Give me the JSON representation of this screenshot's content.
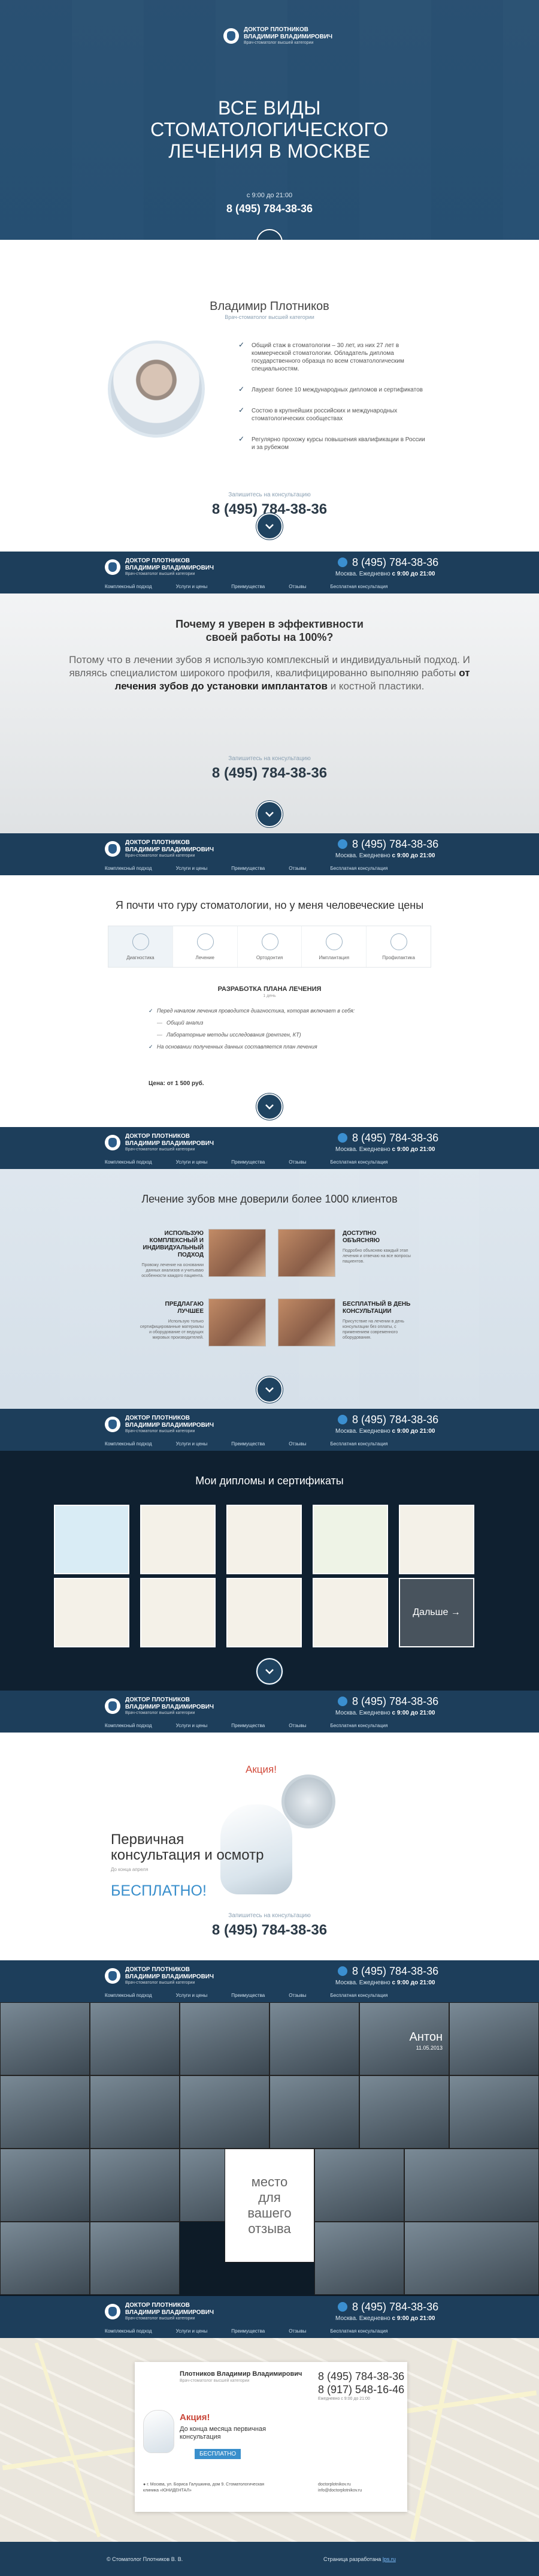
{
  "brand": {
    "name_line1": "ДОКТОР ПЛОТНИКОВ",
    "name_line2": "ВЛАДИМИР ВЛАДИМИРОВИЧ",
    "subtitle": "Врач-стоматолог высшей категории"
  },
  "hero": {
    "title": "ВСЕ ВИДЫ СТОМАТОЛОГИЧЕСКОГО ЛЕЧЕНИЯ В МОСКВЕ",
    "hours": "с 9:00 до 21:00",
    "phone": "8 (495) 784-38-36"
  },
  "doctor": {
    "name": "Владимир Плотников",
    "title": "Врач-стоматолог высшей категории",
    "bullets": [
      "Общий стаж в стоматологии – 30 лет, из них 27 лет в коммерческой стоматологии. Обладатель диплома государственного образца по всем стоматологическим специальностям.",
      "Лауреат более 10 международных дипломов и сертификатов",
      "Состою в крупнейших российских и международных стоматологических сообществах",
      "Регулярно прохожу курсы повышения квалификации в России и за рубежом"
    ],
    "cta_label": "Запишитесь на консультацию",
    "cta_phone": "8 (495) 784-38-36"
  },
  "navbar": {
    "phone": "8 (495) 784-38-36",
    "hours_prefix": "Москва. Ежедневно",
    "hours": "с 9:00 до 21:00",
    "menu": [
      "Комплексный подход",
      "Услуги и цены",
      "Преимущества",
      "Отзывы",
      "Бесплатная консультация"
    ]
  },
  "why": {
    "title_line1": "Почему я уверен в эффективности",
    "title_line2": "своей работы на 100%?",
    "text_part1": "Потому что в лечении зубов я использую комплексный и индивидуальный подход. И являясь специалистом широкого профиля, квалифицированно выполняю работы",
    "text_bold": "от лечения зубов до установки имплантатов",
    "text_part2": "и костной пластики.",
    "cta_label": "Запишитесь на консультацию",
    "cta_phone": "8 (495) 784-38-36"
  },
  "services": {
    "title": "Я почти что гуру стоматологии, но у меня человеческие цены",
    "tabs": [
      "Диагностика",
      "Лечение",
      "Ортодонтия",
      "Имплантация",
      "Профилактика"
    ],
    "plan_title": "РАЗРАБОТКА ПЛАНА ЛЕЧЕНИЯ",
    "plan_sub": "1 день",
    "items": [
      "Перед началом лечения проводится диагностика, которая включает в себя:",
      "Общий анализ",
      "Лабораторные методы исследования (рентген, КТ)",
      "На основании полученных данных составляется план лечения"
    ],
    "price": "Цена: от 1 500 руб."
  },
  "clients": {
    "title": "Лечение зубов мне доверили более 1000 клиентов",
    "items": [
      {
        "title": "ИСПОЛЬЗУЮ КОМПЛЕКСНЫЙ И ИНДИВИДУАЛЬНЫЙ ПОДХОД",
        "desc": "Провожу лечение на основании данных анализов и учитываю особенности каждого пациента."
      },
      {
        "title": "ДОСТУПНО ОБЪЯСНЯЮ",
        "desc": "Подробно объясняю каждый этап лечения и отвечаю на все вопросы пациентов."
      },
      {
        "title": "ПРЕДЛАГАЮ ЛУЧШЕЕ",
        "desc": "Использую только сертифицированные материалы и оборудование от ведущих мировых производителей."
      },
      {
        "title": "БЕСПЛАТНЫЙ В ДЕНЬ КОНСУЛЬТАЦИИ",
        "desc": "Присутствие на лечении в день консультации без оплаты, с применением современного оборудования."
      }
    ]
  },
  "diplomas": {
    "title": "Мои дипломы и сертификаты",
    "more": "Дальше →"
  },
  "promo": {
    "badge": "Акция!",
    "line1": "Первичная",
    "line2": "консультация и осмотр",
    "sub": "До конца апреля",
    "free": "БЕСПЛАТНО!",
    "cta_label": "Запишитесь на консультацию",
    "cta_phone": "8 (495) 784-38-36"
  },
  "reviews": {
    "name": "Антон",
    "date": "11.05.2013",
    "empty_line1": "место",
    "empty_line2": "для",
    "empty_line3": "вашего",
    "empty_line4": "отзыва"
  },
  "contacts": {
    "name": "Плотников Владимир Владимирович",
    "subtitle": "Врач-стоматолог высшей категории",
    "phone1": "8 (495) 784-38-36",
    "phone2": "8 (917) 548-16-46",
    "hours": "Ежедневно с 9:00 до 21:00",
    "promo_title": "Акция!",
    "promo_text": "До конца месяца первичная консультация",
    "promo_free": "БЕСПЛАТНО",
    "address": "г. Москва, ул. Бориса Галушкина, дом 9. Стоматологическая клиника «ЮНИДЕНТАЛ»",
    "site": "doctorplotnikov.ru",
    "email": "info@doctorplotnikov.ru"
  },
  "footer": {
    "copyright": "© Стоматолог Плотников В. В.",
    "dev_text": "Страница разработана",
    "dev_link": "lps.ru"
  },
  "colors": {
    "navy": "#1d3e5b",
    "accent_blue": "#3a8fcc",
    "promo_red": "#d14a3a"
  }
}
